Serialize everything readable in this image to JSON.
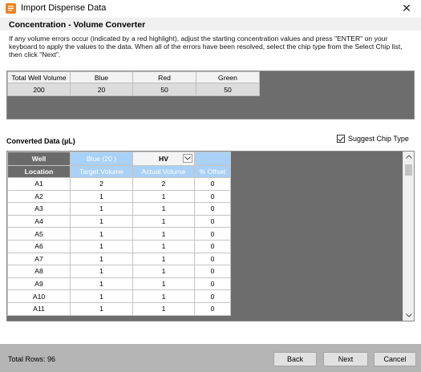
{
  "window": {
    "title": "Import Dispense Data",
    "close_glyph": "✕"
  },
  "section_title": "Concentration - Volume Converter",
  "instructions": "If any volume errors occur (indicated by a red highlight), adjust the starting concentration values and press \"ENTER\" on your keyboard to apply the values to the data. When all of the errors have been resolved, select the chip type from the Select Chip list, then click \"Next\".",
  "volume_table": {
    "headers": [
      "Total Well Volume",
      "Blue",
      "Red",
      "Green"
    ],
    "values": [
      "200",
      "20",
      "50",
      "50"
    ]
  },
  "converted_label": "Converted Data (µL)",
  "suggest_chip": {
    "label": "Suggest Chip Type",
    "checked": true
  },
  "grid": {
    "header_row1": {
      "well": "Well",
      "blue": "Blue (20 )",
      "chip": "HV"
    },
    "header_row2": [
      "Location",
      "Target Volume",
      "Actual Volume",
      "% Offset"
    ],
    "rows": [
      [
        "A1",
        "2",
        "2",
        "0"
      ],
      [
        "A2",
        "1",
        "1",
        "0"
      ],
      [
        "A3",
        "1",
        "1",
        "0"
      ],
      [
        "A4",
        "1",
        "1",
        "0"
      ],
      [
        "A5",
        "1",
        "1",
        "0"
      ],
      [
        "A6",
        "1",
        "1",
        "0"
      ],
      [
        "A7",
        "1",
        "1",
        "0"
      ],
      [
        "A8",
        "1",
        "1",
        "0"
      ],
      [
        "A9",
        "1",
        "1",
        "0"
      ],
      [
        "A10",
        "1",
        "1",
        "0"
      ],
      [
        "A11",
        "1",
        "1",
        "0"
      ]
    ]
  },
  "footer": {
    "total_rows": "Total Rows: 96",
    "back": "Back",
    "next": "Next",
    "cancel": "Cancel"
  },
  "colors": {
    "accent_blue": "#a9d0f5",
    "panel_gray": "#6d6d6d",
    "footer_gray": "#b5b5b5",
    "icon_orange": "#f0821e"
  }
}
